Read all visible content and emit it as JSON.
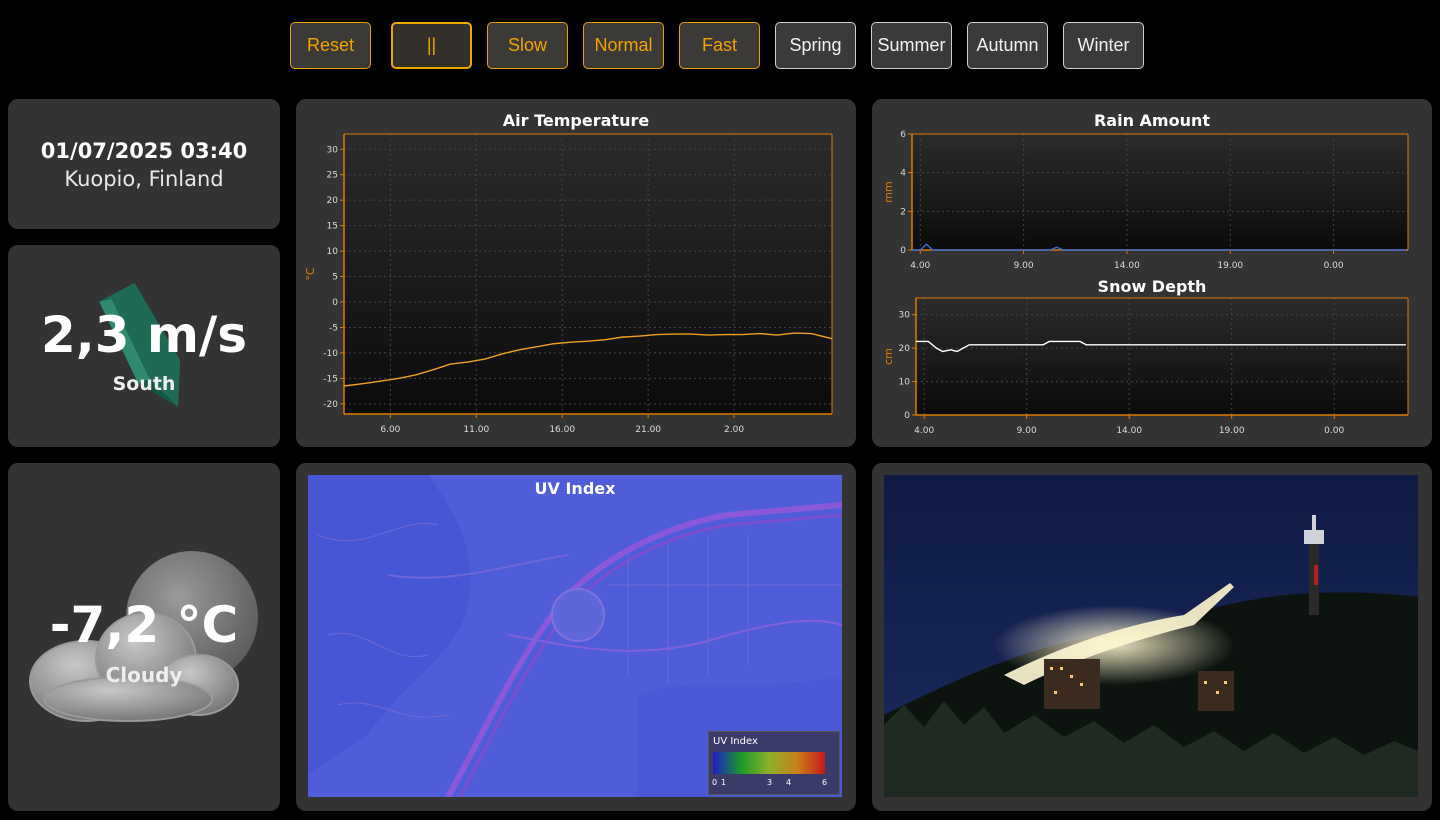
{
  "toolbar": {
    "speed_buttons": [
      {
        "label": "Reset"
      },
      {
        "label": "||"
      },
      {
        "label": "Slow"
      },
      {
        "label": "Normal"
      },
      {
        "label": "Fast"
      }
    ],
    "season_buttons": [
      {
        "label": "Spring"
      },
      {
        "label": "Summer"
      },
      {
        "label": "Autumn"
      },
      {
        "label": "Winter"
      }
    ]
  },
  "info": {
    "datetime": "01/07/2025 03:40",
    "location": "Kuopio, Finland"
  },
  "wind": {
    "speed": "2,3 m/s",
    "direction": "South",
    "icon": "wind-direction-arrow-icon"
  },
  "weather": {
    "temperature": "-7,2 °C",
    "condition": "Cloudy",
    "icon": "cloudy-moon-icon"
  },
  "colors": {
    "accent": "#f5a300",
    "panel": "#333333",
    "temp_line": "#f0a020",
    "rain_line": "#3a6bd8",
    "snow_line": "#ffffff"
  },
  "chart_data": [
    {
      "type": "line",
      "title": "Air Temperature",
      "ylabel": "°C",
      "y_ticks": [
        "30",
        "25",
        "20",
        "15",
        "10",
        "5",
        "0",
        "-5",
        "-10",
        "-15",
        "-20"
      ],
      "x_ticks": [
        "6.00",
        "11.00",
        "16.00",
        "21.00",
        "2.00"
      ],
      "ylim": [
        -22,
        33
      ],
      "xlim": [
        3.3,
        31.7
      ],
      "x_unit": "hour (continuous; values past 24 = next day)",
      "x": [
        3.3,
        4.5,
        5.5,
        6.5,
        7.5,
        8.5,
        9.5,
        10.5,
        11.5,
        12.5,
        13.5,
        14.5,
        15.5,
        16.5,
        17.5,
        18.5,
        19.5,
        20.5,
        21.5,
        22.5,
        23.5,
        24.5,
        25.5,
        26.5,
        27.5,
        28.5,
        29.5,
        30.5,
        31.7
      ],
      "values": [
        -16.5,
        -16.0,
        -15.5,
        -15.0,
        -14.3,
        -13.3,
        -12.2,
        -11.8,
        -11.2,
        -10.2,
        -9.4,
        -8.8,
        -8.2,
        -7.9,
        -7.7,
        -7.4,
        -6.9,
        -6.7,
        -6.4,
        -6.3,
        -6.3,
        -6.5,
        -6.4,
        -6.4,
        -6.2,
        -6.5,
        -6.1,
        -6.2,
        -7.2
      ],
      "grid": true
    },
    {
      "type": "line",
      "title": "Rain Amount",
      "ylabel": "mm",
      "y_ticks": [
        "6",
        "4",
        "2",
        "0"
      ],
      "x_ticks": [
        "4.00",
        "9.00",
        "14.00",
        "19.00",
        "0.00"
      ],
      "ylim": [
        0,
        6
      ],
      "x_unit": "hour",
      "x": [
        3.6,
        4.0,
        4.3,
        4.6,
        10.3,
        10.6,
        10.9,
        27.5
      ],
      "values": [
        0,
        0,
        0.3,
        0,
        0,
        0.15,
        0,
        0
      ],
      "grid": true
    },
    {
      "type": "line",
      "title": "Snow Depth",
      "ylabel": "cm",
      "y_ticks": [
        "30",
        "20",
        "10",
        "0"
      ],
      "x_ticks": [
        "4.00",
        "9.00",
        "14.00",
        "19.00",
        "0.00"
      ],
      "ylim": [
        0,
        35
      ],
      "x_unit": "hour",
      "x": [
        3.6,
        4.2,
        4.6,
        4.9,
        5.3,
        5.6,
        5.9,
        6.2,
        6.6,
        9.8,
        10.1,
        10.4,
        11.6,
        11.9,
        12.2,
        27.5
      ],
      "values": [
        22,
        22,
        20,
        19,
        19.5,
        19,
        20,
        21,
        21,
        21,
        22,
        22,
        22,
        21,
        21,
        21
      ],
      "grid": true
    }
  ],
  "uv": {
    "title": "UV Index",
    "legend_title": "UV Index",
    "legend_ticks": [
      "0",
      "1",
      "3",
      "4",
      "6"
    ]
  },
  "photo": {
    "subject": "kuopio-ski-jump-night-photo"
  }
}
